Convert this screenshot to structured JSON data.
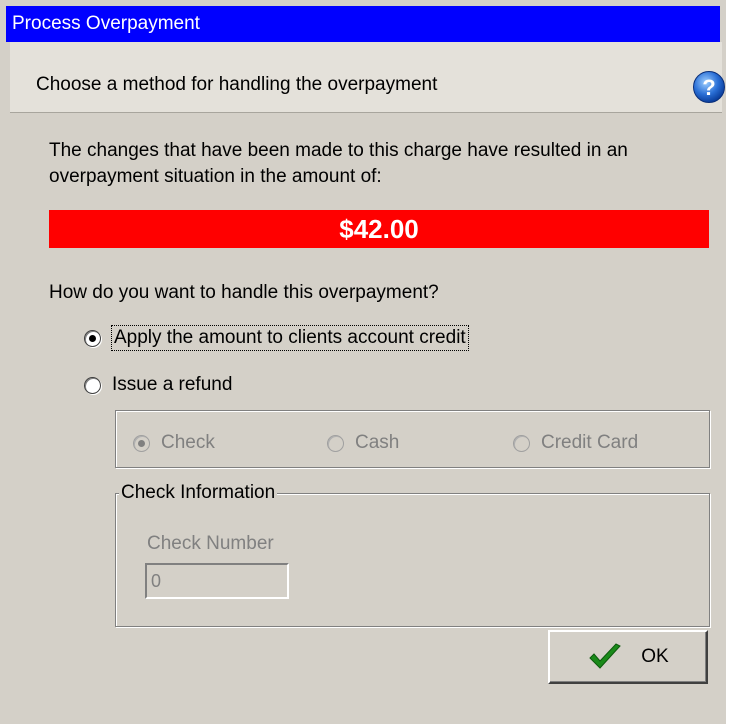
{
  "window": {
    "title": "Process Overpayment"
  },
  "header": {
    "instruction": "Choose a method for handling the overpayment",
    "help_icon": "help-question-icon"
  },
  "message": {
    "text": "The changes that have been made to this charge have resulted in an overpayment situation in the amount of:",
    "amount": "$42.00"
  },
  "options": {
    "question": "How do you want to handle this overpayment?",
    "apply_credit_label": "Apply the amount to clients account credit",
    "issue_refund_label": "Issue a refund",
    "selected": "apply_credit"
  },
  "refund_method": {
    "check_label": "Check",
    "cash_label": "Cash",
    "credit_card_label": "Credit Card",
    "selected": "check"
  },
  "check_info": {
    "group_label": "Check Information",
    "number_label": "Check Number",
    "number_value": "0"
  },
  "buttons": {
    "ok_label": "OK",
    "ok_icon": "checkmark-icon"
  },
  "colors": {
    "titlebar": "#0000ff",
    "amount_bar": "#ff0000",
    "checkmark": "#1a8a1a"
  }
}
